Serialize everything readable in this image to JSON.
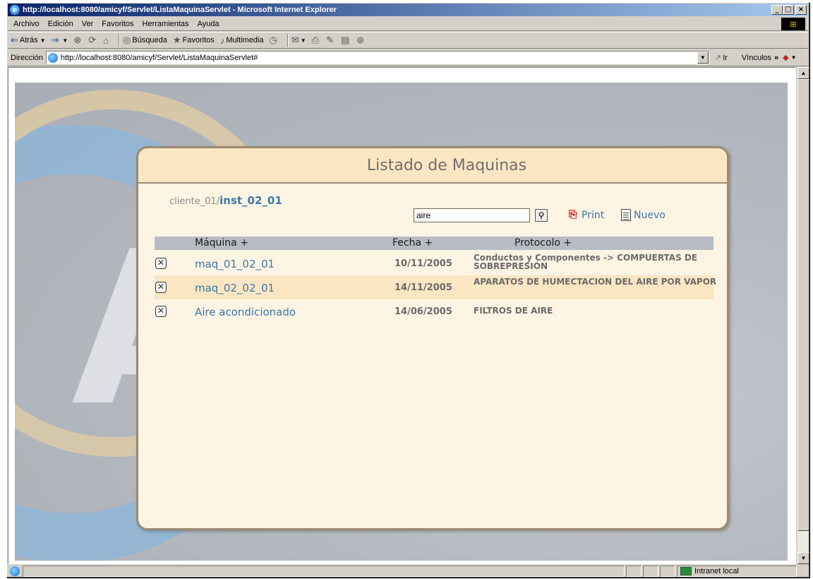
{
  "window": {
    "title": "http://localhost:8080/amicyf/Servlet/ListaMaquinaServlet - Microsoft Internet Explorer",
    "buttons": {
      "minimize": "_",
      "maximize": "□",
      "close": "×"
    }
  },
  "menu": [
    "Archivo",
    "Edición",
    "Ver",
    "Favoritos",
    "Herramientas",
    "Ayuda"
  ],
  "toolbar": {
    "back": "Atrás",
    "search": "Búsqueda",
    "favorites": "Favoritos",
    "multimedia": "Multimedia"
  },
  "address": {
    "label": "Dirección",
    "url": "http://localhost:8080/amicyf/Servlet/ListaMaquinaServlet#",
    "go": "Ir",
    "links": "Vínculos"
  },
  "page": {
    "title": "Listado de Maquinas",
    "breadcrumb": {
      "client": "cliente_01/",
      "installation": "inst_02_01"
    },
    "search": {
      "value": "aire"
    },
    "print_label": "Print",
    "new_label": "Nuevo",
    "columns": {
      "machine": "Máquina +",
      "date": "Fecha +",
      "protocol": "Protocolo +"
    },
    "rows": [
      {
        "name": "maq_01_02_01",
        "date": "10/11/2005",
        "protocol": "Conductos y Componentes -> COMPUERTAS DE SOBREPRESIÓN"
      },
      {
        "name": "maq_02_02_01",
        "date": "14/11/2005",
        "protocol": "APARATOS DE HUMECTACION DEL AIRE POR VAPOR"
      },
      {
        "name": "Aire acondicionado",
        "date": "14/06/2005",
        "protocol": "FILTROS DE AIRE"
      }
    ]
  },
  "status": {
    "zone": "Intranet local"
  },
  "colors": {
    "card_bg": "#fdf4e4",
    "header_bg": "#fbe6c3",
    "link": "#3a78a8",
    "table_head": "#b7bcc4",
    "title_bar": "#0a246a"
  }
}
